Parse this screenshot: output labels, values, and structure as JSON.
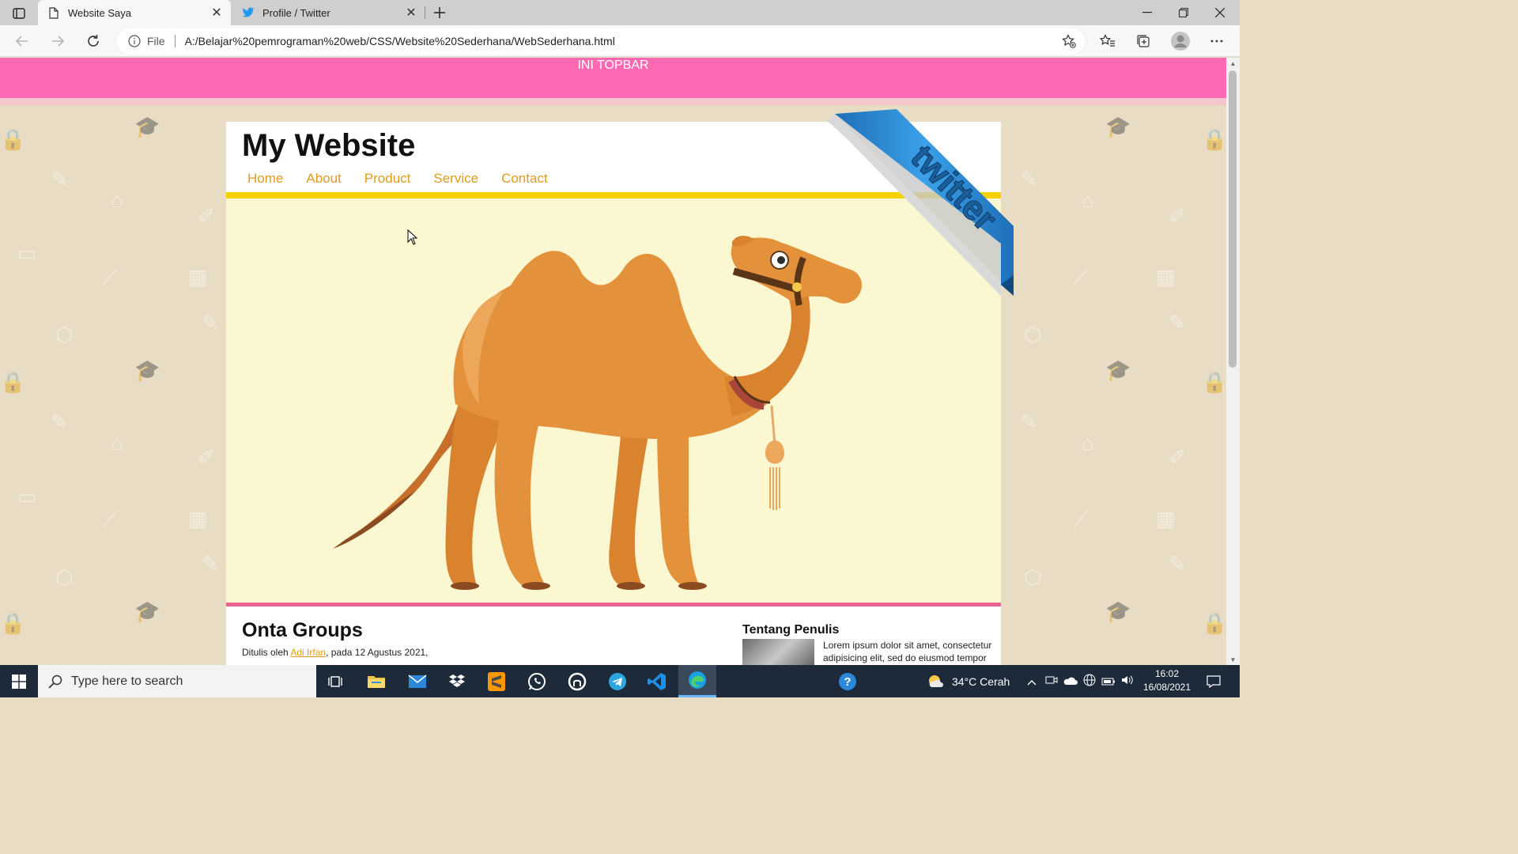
{
  "browser": {
    "tabs": [
      {
        "title": "Website Saya",
        "active": true
      },
      {
        "title": "Profile / Twitter",
        "active": false
      }
    ],
    "file_label": "File",
    "url": "A:/Belajar%20pemrograman%20web/CSS/Website%20Sederhana/WebSederhana.html"
  },
  "page": {
    "topbar_text": "INI TOPBAR",
    "site_title": "My Website",
    "menu": [
      "Home",
      "About",
      "Product",
      "Service",
      "Contact"
    ],
    "ribbon_text": "twitter",
    "article": {
      "title": "Onta Groups",
      "byline_prefix": "Ditulis oleh",
      "author": "Adi Irfan",
      "byline_suffix": ", pada 12 Agustus 2021,"
    },
    "aside": {
      "title": "Tentang Penulis",
      "text": "Lorem ipsum dolor sit amet, consectetur adipisicing elit, sed do eiusmod tempor"
    }
  },
  "taskbar": {
    "search_placeholder": "Type here to search",
    "weather": "34°C  Cerah",
    "time": "16:02",
    "date": "16/08/2021"
  },
  "colors": {
    "topbar": "#ff69b4",
    "menu_link": "#e29b1d",
    "menu_underline": "#f6d200",
    "hero_bg": "#fbf8d1",
    "accent_pink": "#f06292",
    "page_bg": "#e8dcc4"
  }
}
